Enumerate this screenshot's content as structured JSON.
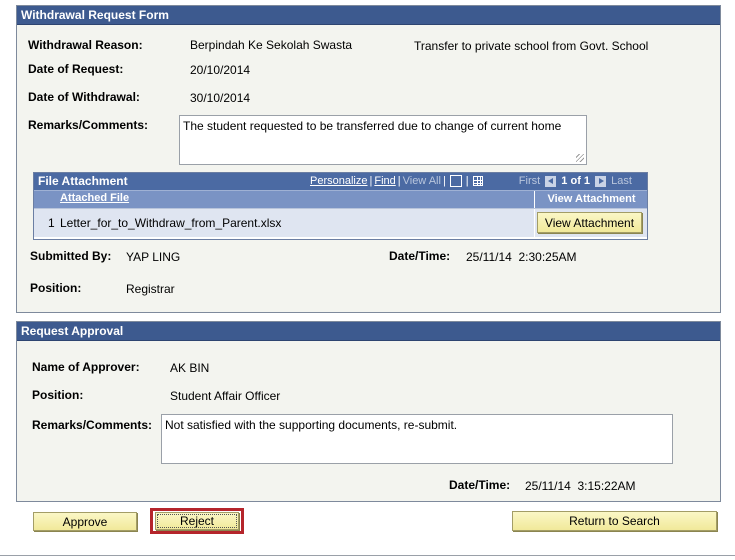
{
  "withdrawal": {
    "title": "Withdrawal Request Form",
    "reason_label": "Withdrawal Reason:",
    "reason_value": "Berpindah Ke Sekolah Swasta",
    "reason_desc": "Transfer to private school from Govt. School",
    "request_date_label": "Date of Request:",
    "request_date_value": "20/10/2014",
    "withdrawal_date_label": "Date of Withdrawal:",
    "withdrawal_date_value": "30/10/2014",
    "remarks_label": "Remarks/Comments:",
    "remarks_value": "The student requested to be transferred due to change of current home",
    "attachment": {
      "title": "File Attachment",
      "personalize": "Personalize",
      "find": "Find",
      "view_all": "View All",
      "first": "First",
      "page_info": "1 of 1",
      "last": "Last",
      "col_file": "Attached File",
      "col_view": "View Attachment",
      "rows": [
        {
          "num": "1",
          "file": "Letter_for_to_Withdraw_from_Parent.xlsx",
          "button": "View Attachment"
        }
      ]
    },
    "submitted_by_label": "Submitted By:",
    "submitted_by_value": "YAP LING",
    "datetime_label": "Date/Time:",
    "datetime_value": "25/11/14  2:30:25AM",
    "position_label": "Position:",
    "position_value": "Registrar"
  },
  "approval": {
    "title": "Request Approval",
    "approver_label": "Name of Approver:",
    "approver_value": "AK BIN",
    "position_label": "Position:",
    "position_value": "Student Affair Officer",
    "remarks_label": "Remarks/Comments:",
    "remarks_value": "Not satisfied with the supporting documents, re-submit.",
    "datetime_label": "Date/Time:",
    "datetime_value": "25/11/14  3:15:22AM"
  },
  "actions": {
    "approve": "Approve",
    "reject": "Reject",
    "return": "Return to Search"
  },
  "colors": {
    "header_blue": "#3d5a8f",
    "button_yellow": "#f5efb0",
    "highlight_red": "#b5252b"
  }
}
